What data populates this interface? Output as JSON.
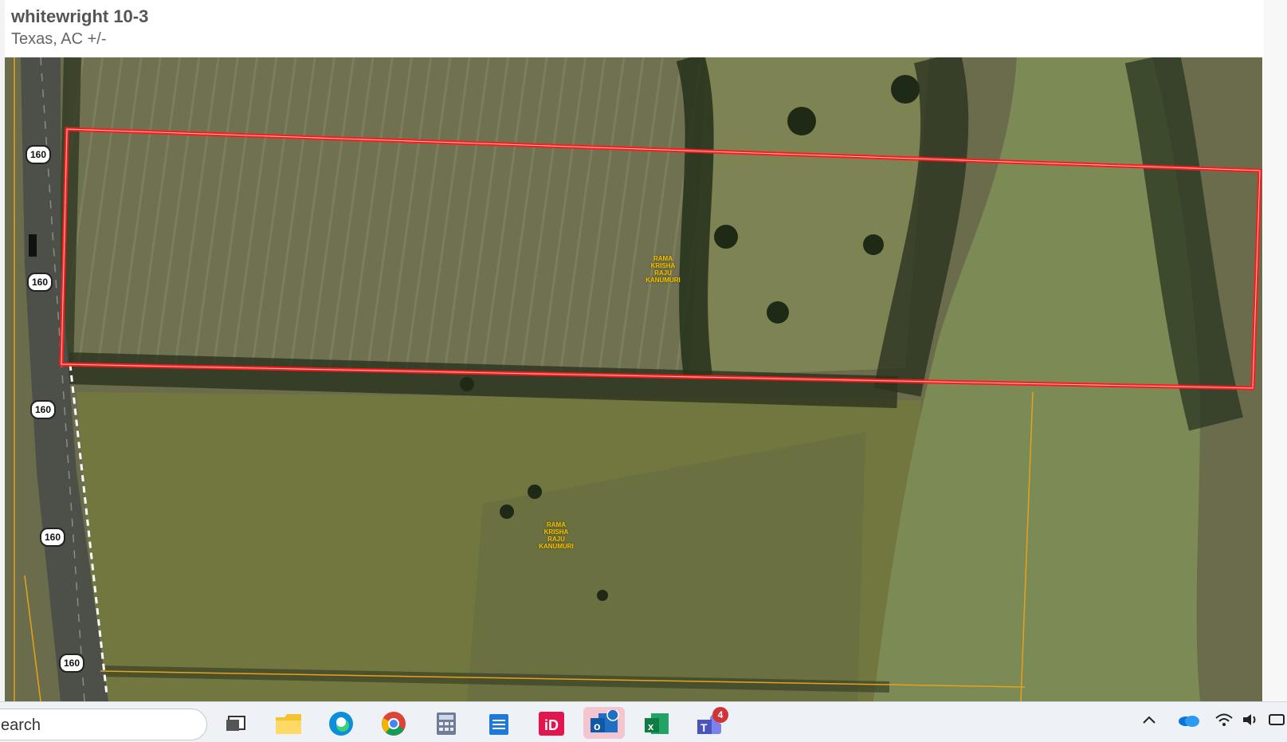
{
  "header": {
    "title": "whitewright 10-3",
    "subtitle": "Texas,  AC +/-"
  },
  "map": {
    "owner_labels": [
      [
        "RAMA",
        "KRISHA",
        "RAJU",
        "KANUMURI"
      ],
      [
        "RAMA",
        "KRISHA",
        "RAJU",
        "KANUMURI"
      ]
    ],
    "route_shields": [
      "160",
      "160",
      "160",
      "160",
      "160"
    ],
    "colors": {
      "parcel_outline": "#ff1a1a",
      "owner_label": "#f2c200",
      "parcel_lines": "#e8a21a"
    }
  },
  "taskbar": {
    "search_text": "earch",
    "teams_badge": "4",
    "icons": [
      "task-view-icon",
      "file-explorer-icon",
      "edge-icon",
      "chrome-icon",
      "calculator-icon",
      "notepad-icon",
      "indesign-icon",
      "outlook-icon",
      "excel-icon",
      "teams-icon"
    ],
    "tray": [
      "chevron-up-icon",
      "onedrive-icon",
      "wifi-icon",
      "volume-icon",
      "battery-icon"
    ]
  }
}
